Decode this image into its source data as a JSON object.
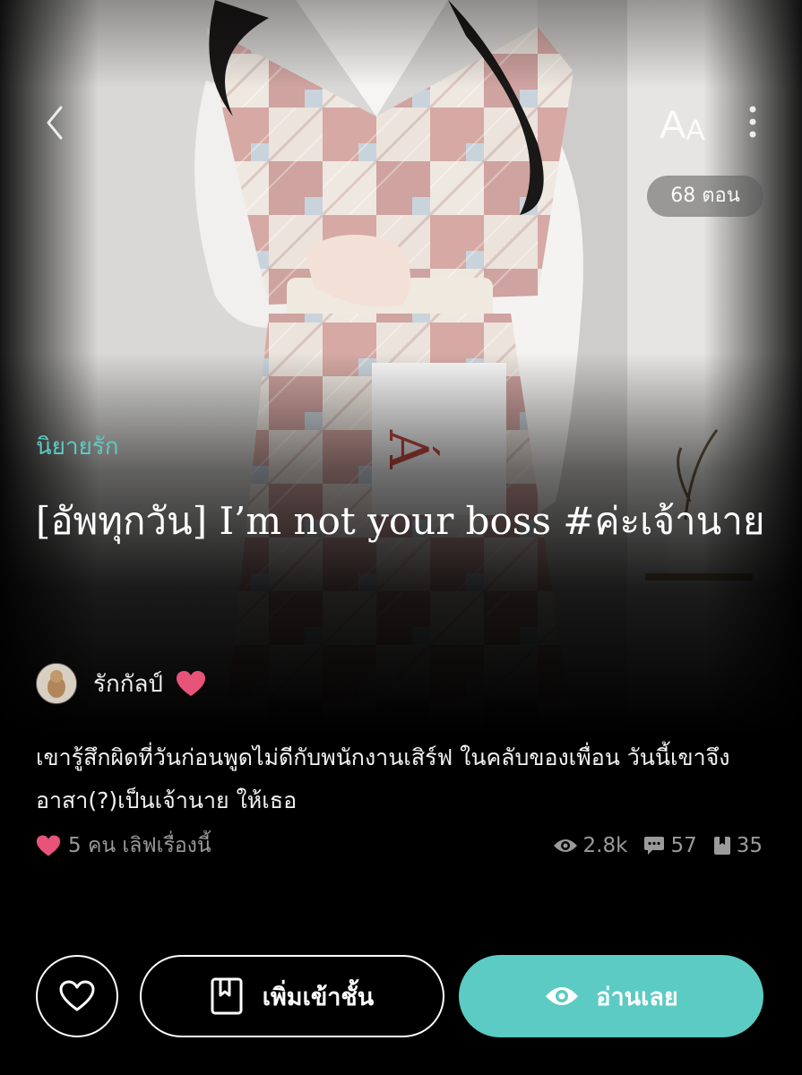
{
  "header": {
    "font_size_label_big": "A",
    "font_size_label_small": "A",
    "episodes_badge": "68 ตอน"
  },
  "story": {
    "category": "นิยายรัก",
    "title": "[อัพทุกวัน] I’m not your boss #ค่ะเจ้านาย",
    "author": "รักกัลป์",
    "synopsis": "เขารู้สึกผิดที่วันก่อนพูดไม่ดีกับพนักงานเสิร์ฟ ในคลับของเพื่อน วันนี้เขาจึงอาสา(?)เป็นเจ้านาย ให้เธอ",
    "love_count_text": "5 คน เลิฟเรื่องนี้"
  },
  "stats": {
    "views": "2.8k",
    "comments": "57",
    "bookmarks": "35"
  },
  "actions": {
    "add_to_library": "เพิ่มเข้าชั้น",
    "read_now": "อ่านเลย"
  },
  "colors": {
    "accent": "#5ccbc3",
    "heart": "#e8537a",
    "background": "#000000",
    "muted_text": "#9a9a9a"
  },
  "icons": [
    "back-chevron-icon",
    "font-size-icon",
    "more-vertical-icon",
    "heart-icon",
    "eye-icon",
    "comment-icon",
    "bookmark-icon",
    "book-icon"
  ]
}
